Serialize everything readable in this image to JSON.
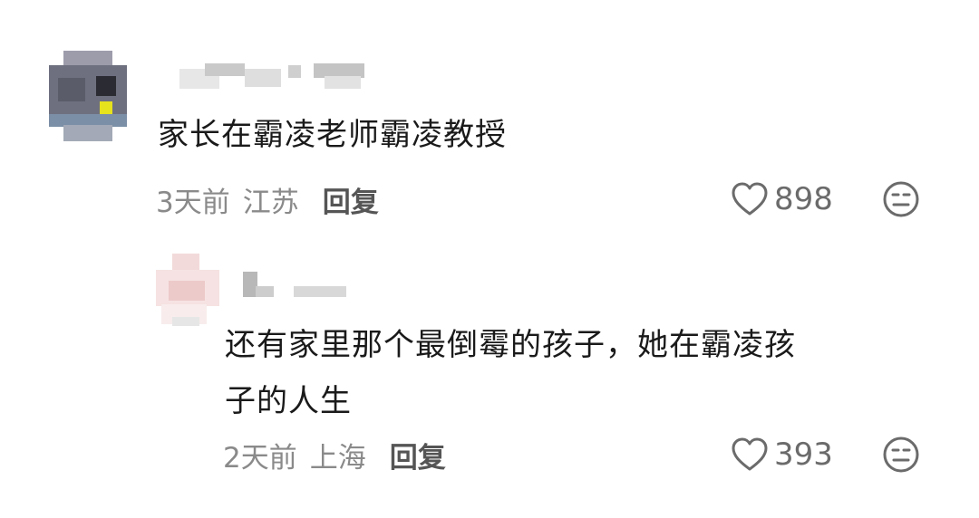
{
  "comments": [
    {
      "text": "家长在霸凌老师霸凌教授",
      "time": "3天前",
      "location": "江苏",
      "reply_label": "回复",
      "likes": "898"
    },
    {
      "text_line1": "还有家里那个最倒霉的孩子，她在霸凌孩",
      "text_line2": "子的人生",
      "time": "2天前",
      "location": "上海",
      "reply_label": "回复",
      "likes": "393"
    }
  ],
  "colors": {
    "text": "#1a1a1a",
    "meta": "#8a8a8a",
    "reply": "#555555",
    "icon": "#6b6b6b"
  },
  "icons": [
    "heart-icon",
    "dislike-face-icon"
  ]
}
